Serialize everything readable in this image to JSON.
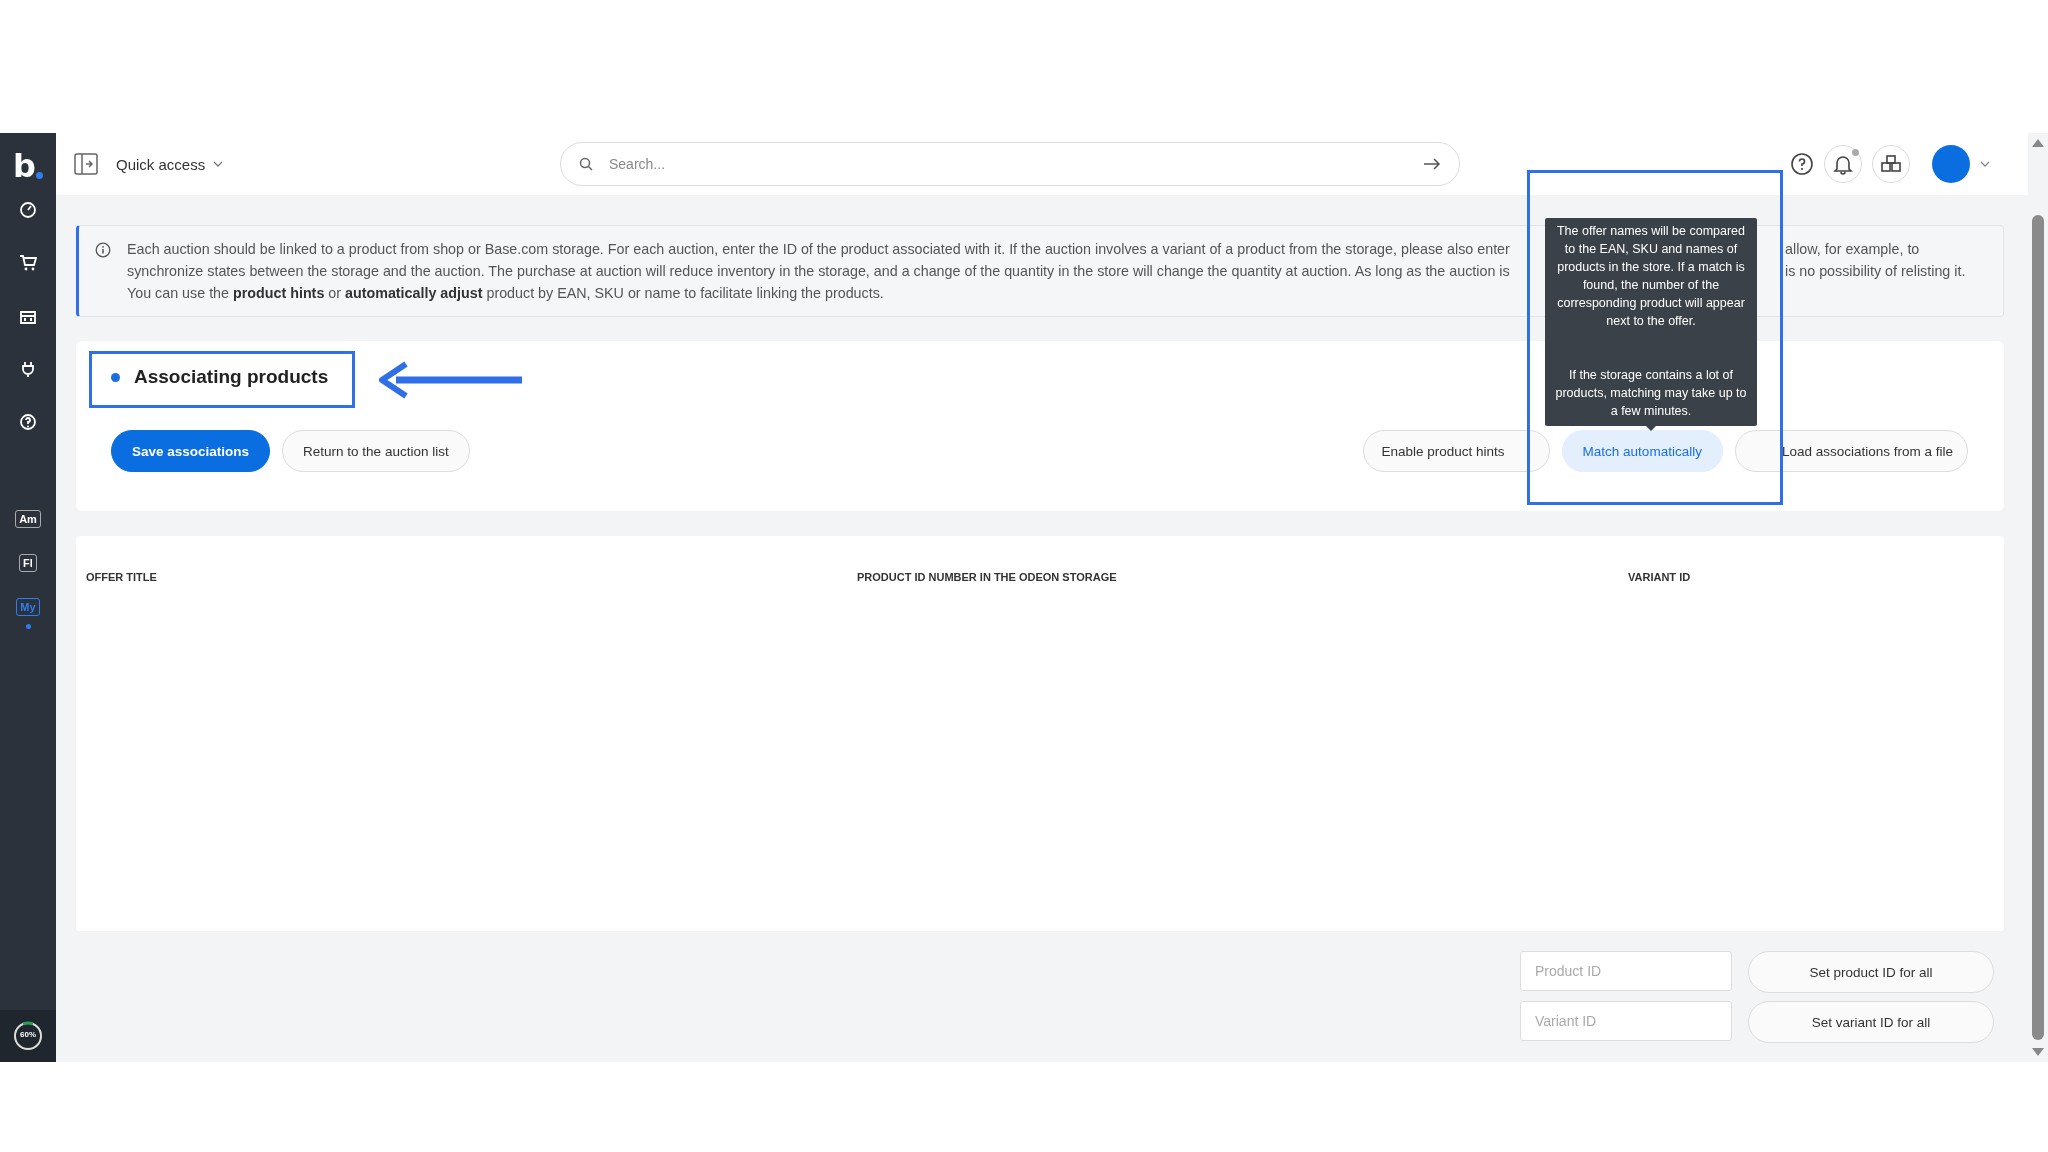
{
  "sidebar": {
    "logo": "b",
    "shortcuts": [
      {
        "label": "Am",
        "selected": false
      },
      {
        "label": "Fl",
        "selected": false
      },
      {
        "label": "My",
        "selected": true
      }
    ],
    "progress_label": "60%"
  },
  "header": {
    "quick_access": "Quick access",
    "search": {
      "placeholder": "Search..."
    }
  },
  "info_banner": {
    "lines": [
      {
        "left": "Each auction should be linked to a product from shop or Base.com storage. For each auction, enter the ID of the product associated with it. If the auction involves a variant of a product from the storage, please also enter",
        "right": "allow, for example, to"
      },
      {
        "left": "synchronize states between the storage and the auction. The purchase at auction will reduce inventory in the storage, and a change of the quantity in the store will change the quantity at auction. As long as the auction is",
        "right": "is no possibility of relisting it."
      },
      {
        "left": "You can use the **product hints** or **automatically adjust** product by EAN, SKU or name to facilitate linking the products."
      }
    ]
  },
  "section": {
    "title": "Associating products",
    "buttons": [
      {
        "label": "Save associations",
        "kind": "primary"
      },
      {
        "label": "Return to the auction list",
        "kind": "secondary"
      },
      {
        "label": "Enable product hints",
        "kind": "secondary"
      },
      {
        "label": "Match automatically",
        "kind": "highlighted"
      },
      {
        "label": "Load associations from a file",
        "kind": "secondary"
      }
    ]
  },
  "tooltip": {
    "paragraphs": [
      "The offer names will be compared to the EAN, SKU and names of products in the store. If a match is found, the number of the corresponding product will appear next to the offer.",
      "If the storage contains a lot of products, matching may take up to a few minutes."
    ]
  },
  "table": {
    "columns": [
      "OFFER TITLE",
      "PRODUCT ID NUMBER IN THE ODEON STORAGE",
      "VARIANT ID"
    ]
  },
  "bulk_actions": [
    {
      "placeholder": "Product ID",
      "button": "Set product ID for all"
    },
    {
      "placeholder": "Variant ID",
      "button": "Set variant ID for all"
    }
  ]
}
